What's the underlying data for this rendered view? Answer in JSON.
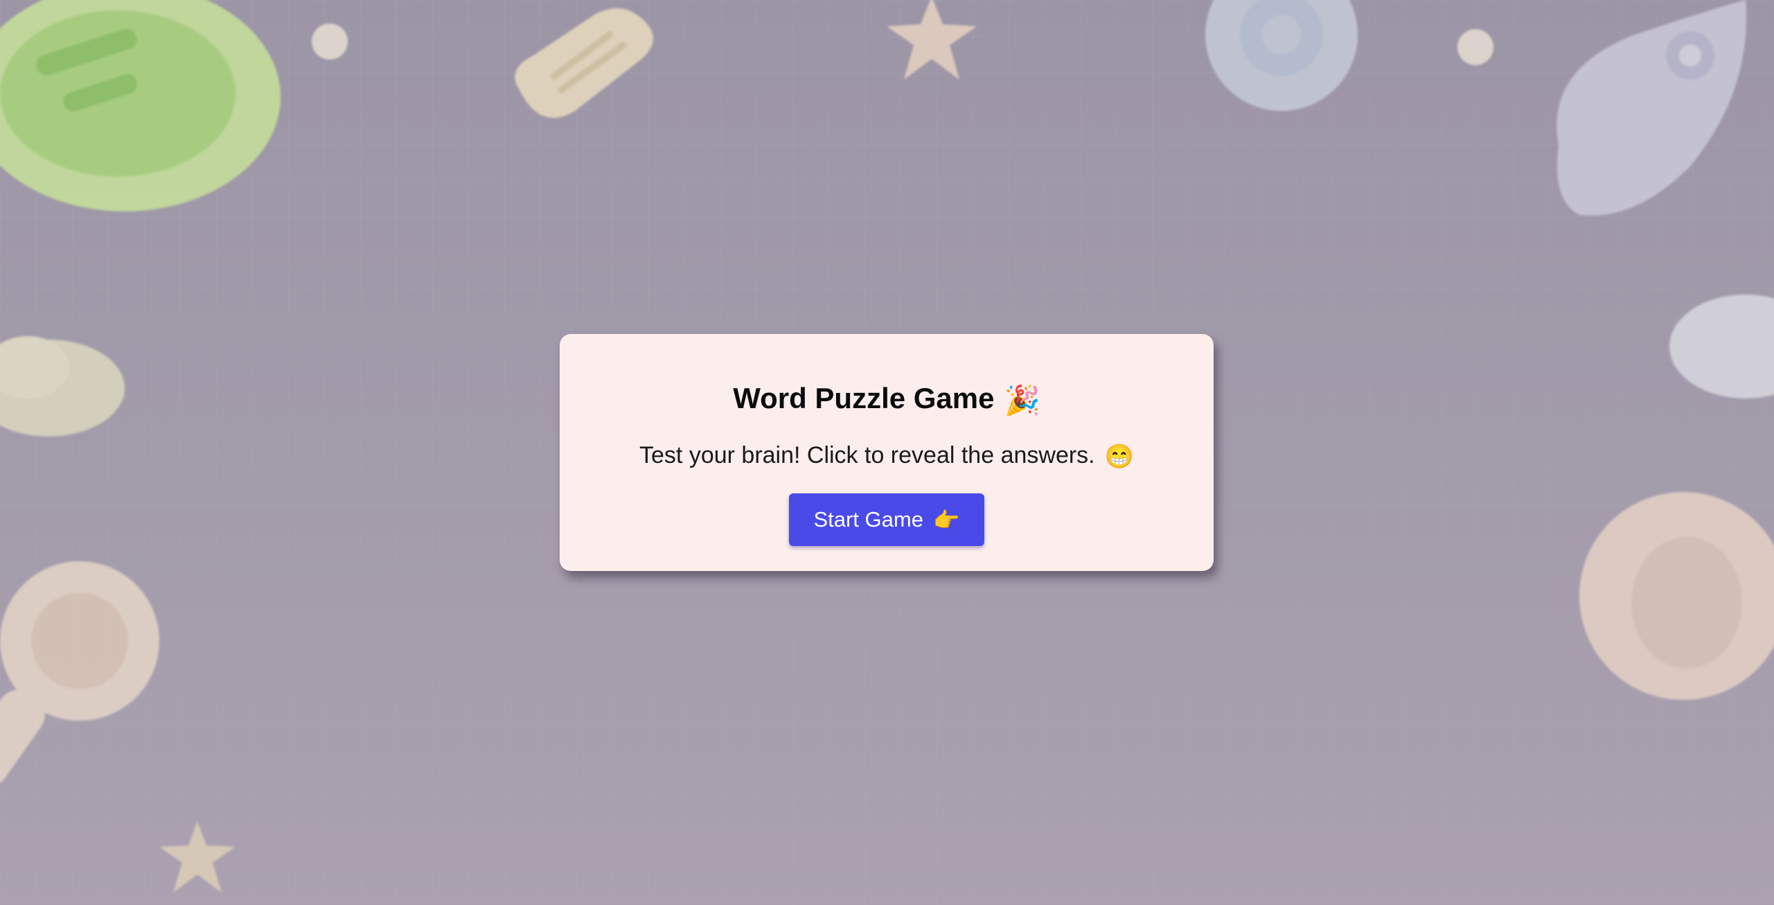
{
  "card": {
    "title": "Word Puzzle Game",
    "title_emoji": "🎉",
    "subtitle": "Test your brain! Click to reveal the answers.",
    "subtitle_emoji": "😁",
    "start_button_label": "Start Game",
    "start_button_emoji": "👉"
  },
  "colors": {
    "background": "#a39cab",
    "card_background": "#fdeeee",
    "button_background": "#4a4ae9",
    "button_text": "#ffffff"
  },
  "background_decorations": [
    "lightbulb-icon",
    "puzzle-piece-icon",
    "star-icon",
    "gear-icon",
    "rocket-icon",
    "cloud-icon",
    "magnifier-icon",
    "bubble-icon"
  ]
}
